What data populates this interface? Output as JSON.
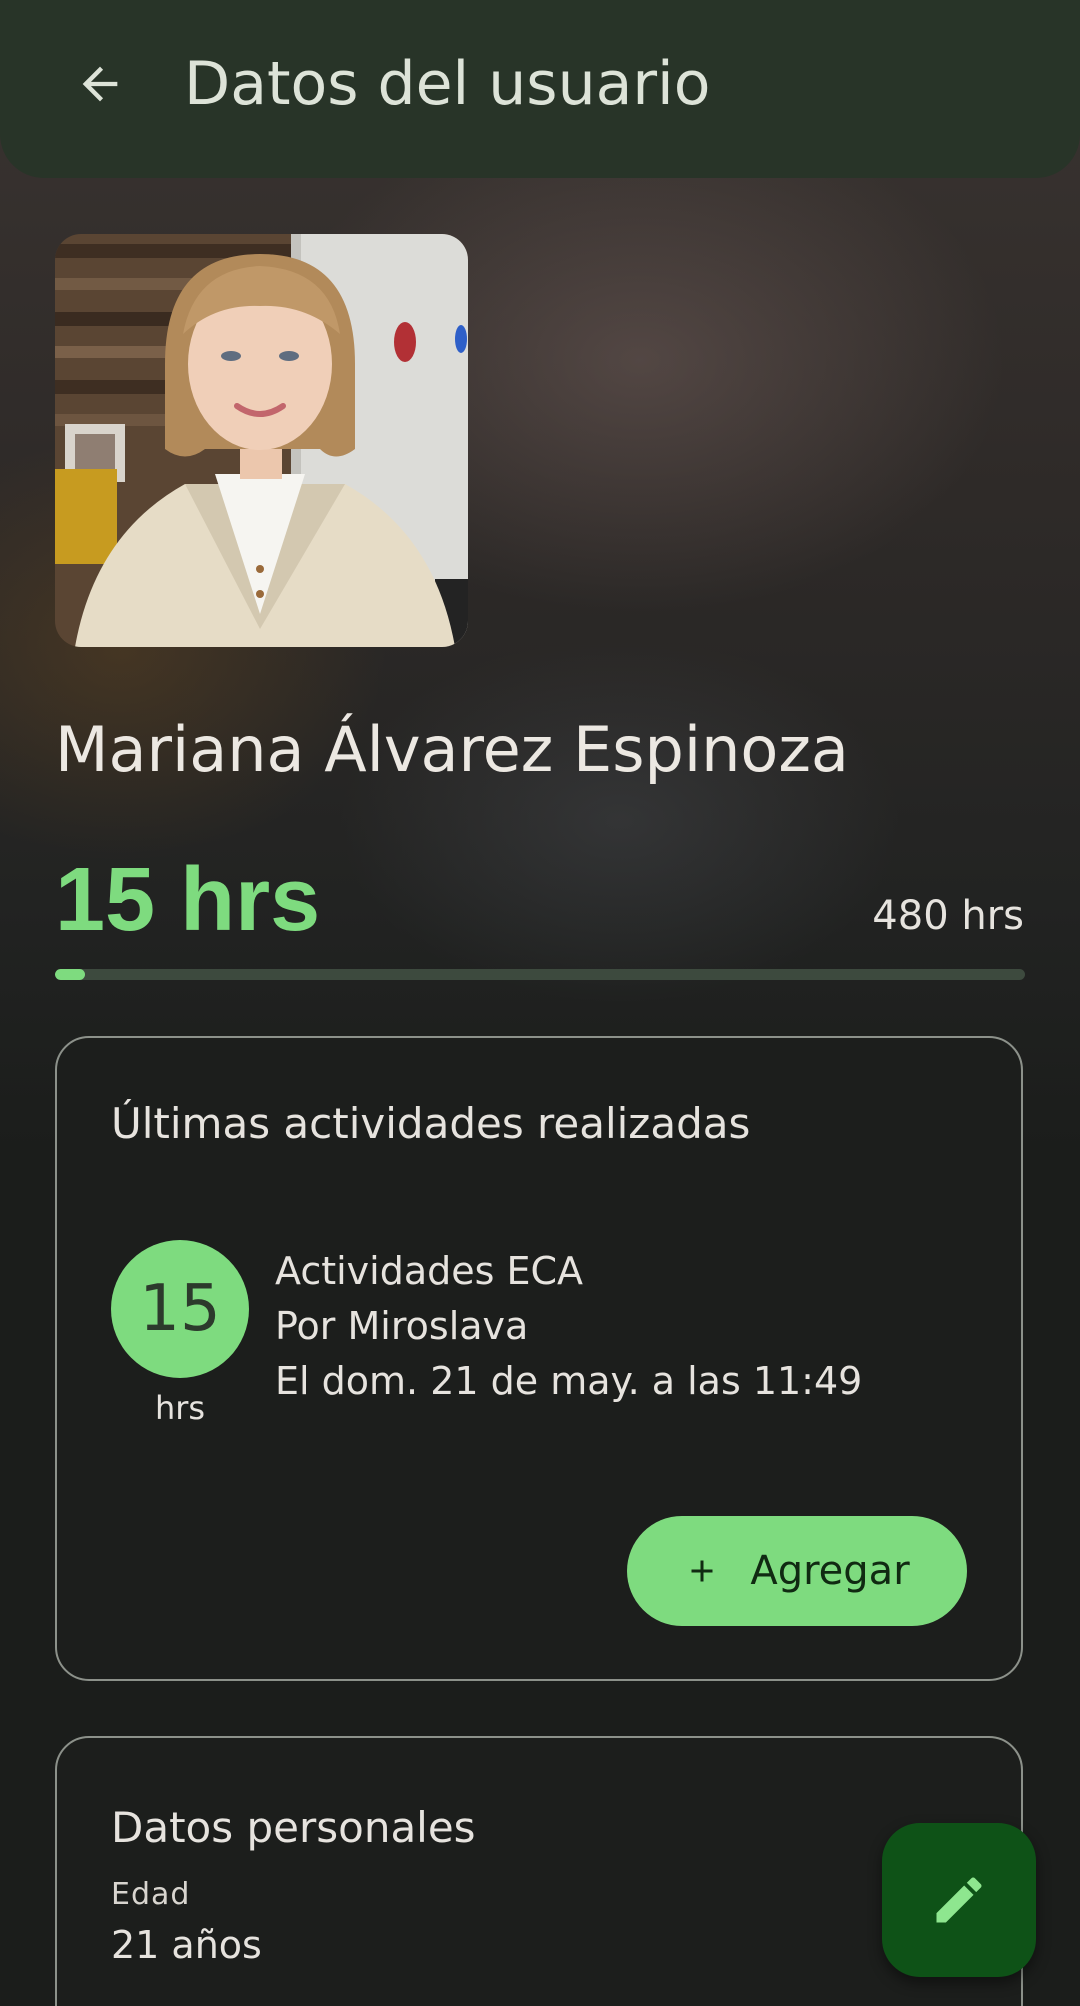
{
  "app_bar": {
    "title": "Datos del usuario",
    "back_icon": "arrow-back-icon"
  },
  "user": {
    "name": "Mariana Álvarez Espinoza",
    "avatar_icon": "user-photo"
  },
  "hours": {
    "current_label": "15 hrs",
    "goal_label": "480 hrs",
    "current": 15,
    "goal": 480,
    "progress_fraction": 0.03125
  },
  "activities_card": {
    "title": "Últimas actividades realizadas",
    "activity": {
      "hours": "15",
      "unit": "hrs",
      "name": "Actividades ECA",
      "by": "Por Miroslava",
      "date": "El dom. 21 de may. a las 11:49"
    },
    "add_button": {
      "label": "Agregar",
      "icon": "plus-icon"
    }
  },
  "personal_card": {
    "title": "Datos personales",
    "age_label": "Edad",
    "age_value": "21 años"
  },
  "fab": {
    "icon": "pencil-icon"
  },
  "colors": {
    "accent": "#7edb7f",
    "app_bar": "#283428",
    "fab": "#0e5217",
    "card_border": "#8c918a"
  }
}
